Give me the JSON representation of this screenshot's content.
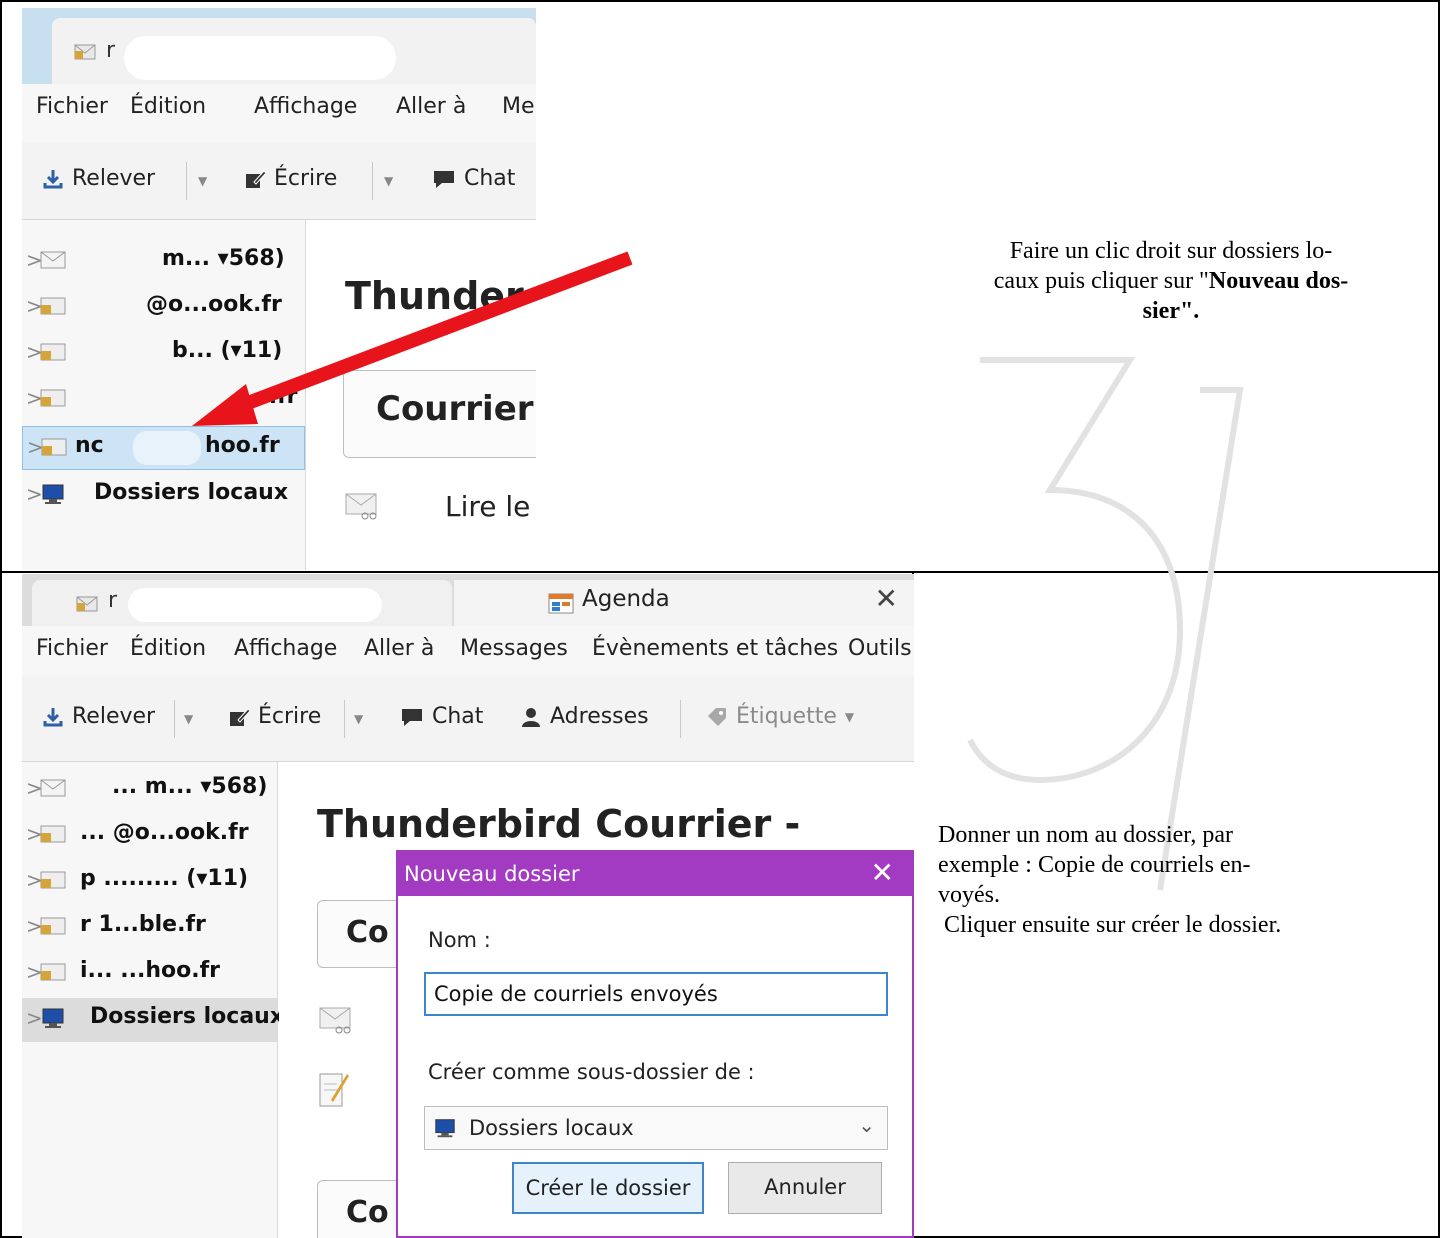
{
  "top_panel": {
    "tab_title": "r",
    "menu": [
      "Fichier",
      "Édition",
      "Affichage",
      "Aller à",
      "Me"
    ],
    "toolbar": {
      "get": "Relever",
      "write": "Écrire",
      "chat": "Chat"
    },
    "folders": [
      {
        "label": "m... ▾568)"
      },
      {
        "label": "@o...ook.fr"
      },
      {
        "label": "b... (▾11)"
      },
      {
        "label": "...fr"
      },
      {
        "label": "nc",
        "label2": "hoo.fr"
      },
      {
        "label": "Dossiers locaux"
      }
    ],
    "content_title": "Thunder",
    "courrier_button": "Courrier",
    "read_link": "Lire le",
    "instruction": {
      "line1": "Faire un clic droit sur dossiers lo-",
      "line2": "caux puis cliquer sur \"",
      "bold": "Nouveau dos-",
      "line3_bold": "sier\"."
    }
  },
  "bottom_panel": {
    "tab_title": "r",
    "agenda_tab": "Agenda",
    "menu": [
      "Fichier",
      "Édition",
      "Affichage",
      "Aller à",
      "Messages",
      "Évènements et tâches",
      "Outils"
    ],
    "toolbar": {
      "get": "Relever",
      "write": "Écrire",
      "chat": "Chat",
      "addresses": "Adresses",
      "tag": "Étiquette"
    },
    "folders": [
      {
        "label": "... m... ▾568)"
      },
      {
        "label": "... @o...ook.fr"
      },
      {
        "label": "p ......... (▾11)"
      },
      {
        "label": "r 1...ble.fr"
      },
      {
        "label": "i... ...hoo.fr"
      },
      {
        "label": "Dossiers locaux"
      }
    ],
    "content_title": "Thunderbird Courrier -",
    "courrier_button_1": "Co",
    "courrier_button_2": "Co",
    "dialog": {
      "title": "Nouveau dossier",
      "name_label": "Nom :",
      "name_value": "Copie de courriels envoyés",
      "parent_label": "Créer comme sous-dossier de :",
      "parent_value": "Dossiers locaux",
      "create_button": "Créer le dossier",
      "cancel_button": "Annuler"
    },
    "instruction": {
      "line1": "Donner un nom au dossier, par",
      "line2": "exemple : Copie de courriels en-",
      "line3": "voyés.",
      "line4": " Cliquer ensuite sur créer le dossier."
    }
  },
  "colors": {
    "dialog_accent": "#a23bc1",
    "selection": "#cde4f7",
    "arrow": "#e8141c",
    "input_focus": "#3b86c8"
  },
  "icons": [
    "download-icon",
    "pencil-icon",
    "chat-bubble-icon",
    "person-icon",
    "tag-icon",
    "envelope-icon",
    "computer-icon",
    "close-icon",
    "chevron-down-icon"
  ]
}
